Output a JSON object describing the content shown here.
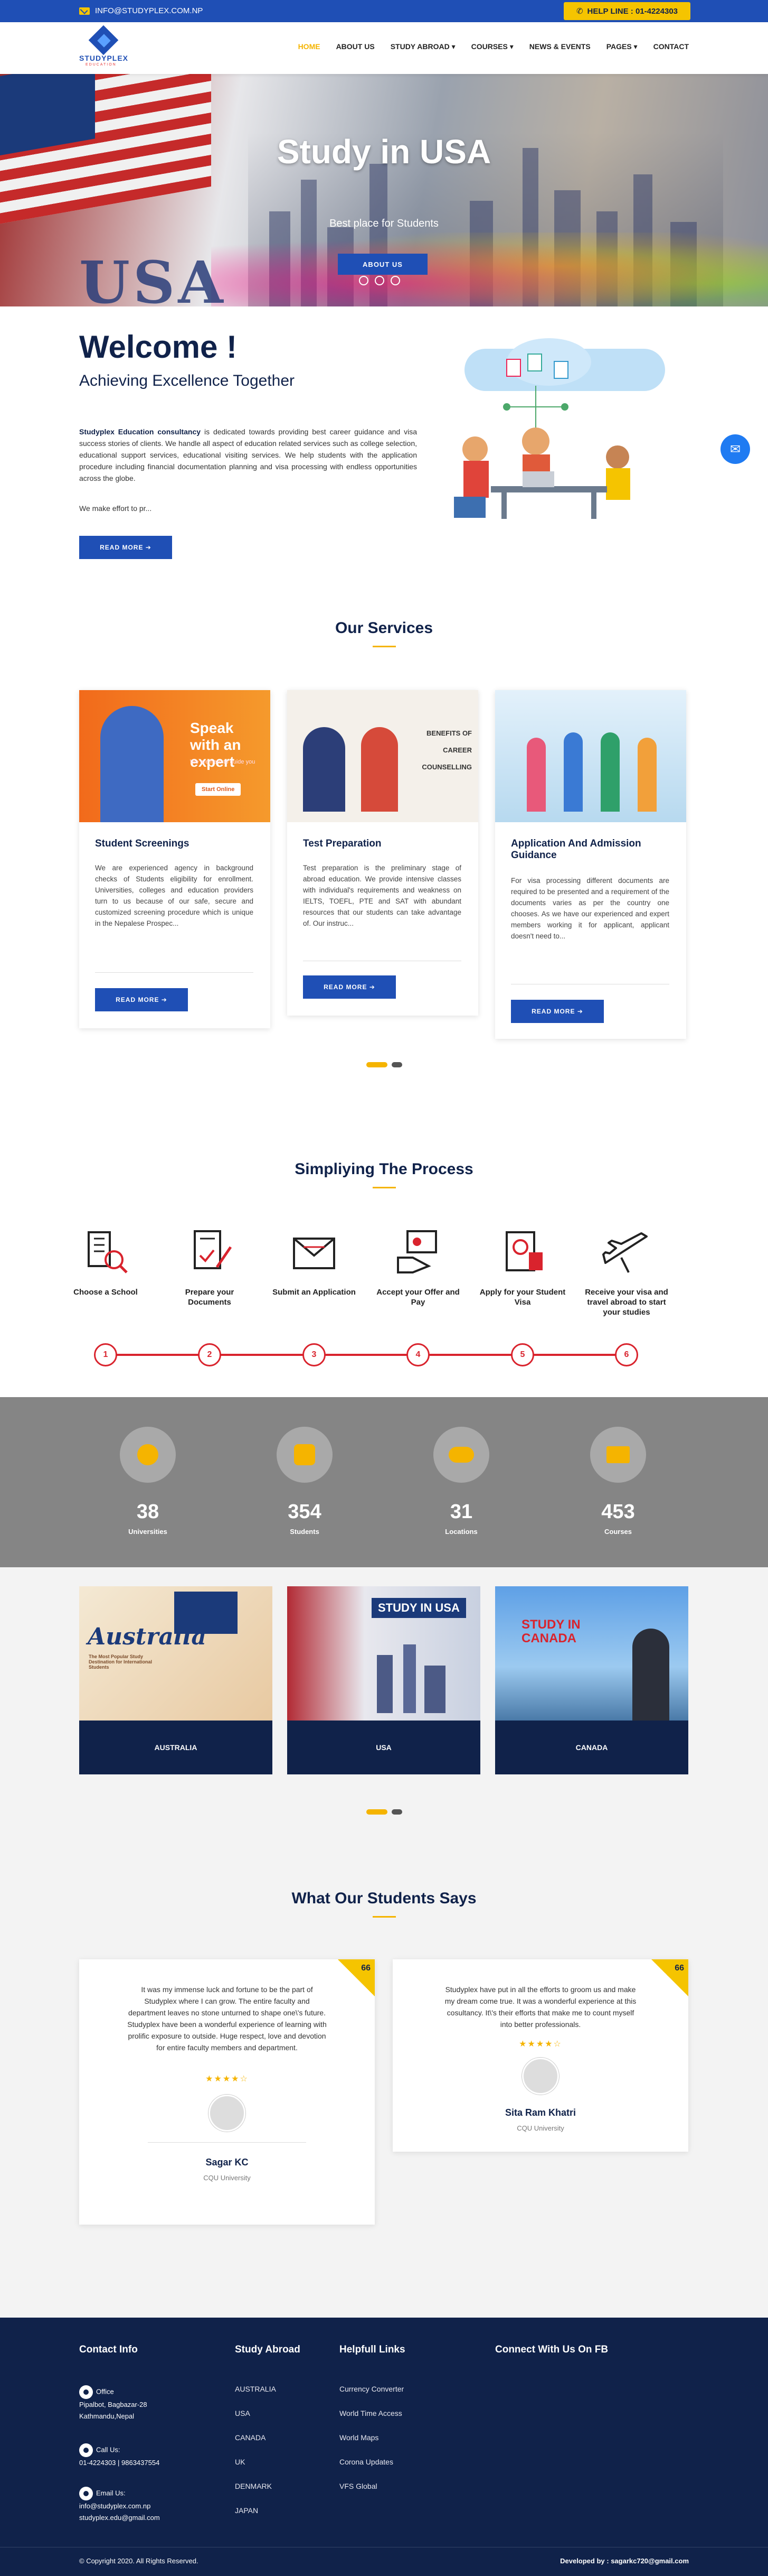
{
  "topbar": {
    "email": "INFO@STUDYPLEX.COM.NP",
    "helpline": "HELP LINE : 01-4224303"
  },
  "brand": {
    "name": "STUDYPLEX",
    "tagline": "EDUCATION"
  },
  "nav": [
    "HOME",
    "ABOUT US",
    "STUDY ABROAD ▾",
    "COURSES ▾",
    "NEWS & EVENTS",
    "PAGES ▾",
    "CONTACT"
  ],
  "hero": {
    "title": "Study in USA",
    "tagline": "Best place for Students",
    "button": "ABOUT US",
    "bg_text": "USA"
  },
  "welcome": {
    "title": "Welcome !",
    "subtitle": "Achieving Excellence Together",
    "brand_bold": "Studyplex Education consultancy",
    "body": " is dedicated towards providing best career guidance and visa success stories of clients.  We handle all aspect of education related services such as college selection, educational support services, educational visiting services.    We  help students with the application procedure including financial documentation planning and visa processing with endless opportunities across the globe.",
    "more": "We make effort to pr...",
    "button": "READ MORE ➔"
  },
  "services": {
    "heading": "Our Services",
    "items": [
      {
        "title": "Student Screenings",
        "img_text": "Speak with an expert",
        "img_sub": "We are here to guide you",
        "img_btn": "Start Online",
        "text": "We are experienced agency in background checks of Students eligibility for enrollment. Universities, colleges and education providers turn to us because of our safe, secure and customized screening procedure which is unique in the Nepalese Prospec...",
        "button": "READ MORE ➔"
      },
      {
        "title": "Test Preparation",
        "img_text": "BENEFITS OF CAREER COUNSELLING",
        "text": "Test preparation is the preliminary stage of abroad education. We provide intensive classes with individual's requirements and weakness on IELTS, TOEFL, PTE and SAT with abundant resources that our students can take advantage of. Our instruc...",
        "button": "READ MORE ➔"
      },
      {
        "title": "Application And Admission Guidance",
        "img_text": "",
        "text": "For visa processing different documents are required to be presented and a requirement of the documents varies as per the country one chooses. As we have our experienced and expert members working it for applicant, applicant doesn't need to...",
        "button": "READ MORE ➔"
      }
    ]
  },
  "process": {
    "heading": "Simpliying The Process",
    "steps": [
      {
        "label": "Choose a School",
        "num": "1",
        "icon": "building-search-icon"
      },
      {
        "label": "Prepare your Documents",
        "num": "2",
        "icon": "document-pen-icon"
      },
      {
        "label": "Submit an Application",
        "num": "3",
        "icon": "envelope-icon"
      },
      {
        "label": "Accept your Offer and Pay",
        "num": "4",
        "icon": "hand-card-icon"
      },
      {
        "label": "Apply for your Student Visa",
        "num": "5",
        "icon": "passport-icon"
      },
      {
        "label": "Receive your visa and travel abroad to start your studies",
        "num": "6",
        "icon": "airplane-icon"
      }
    ]
  },
  "stats": [
    {
      "num": "38",
      "label": "Universities",
      "icon": "badge-icon"
    },
    {
      "num": "354",
      "label": "Students",
      "icon": "user-icon"
    },
    {
      "num": "31",
      "label": "Locations",
      "icon": "group-icon"
    },
    {
      "num": "453",
      "label": "Courses",
      "icon": "book-icon"
    }
  ],
  "destinations": [
    {
      "label": "AUSTRALIA",
      "img_text": "Australia",
      "img_sub": "The Most Popular Study Destination for International Students"
    },
    {
      "label": "USA",
      "img_text": "STUDY IN USA"
    },
    {
      "label": "CANADA",
      "img_text": "STUDY IN CANADA"
    }
  ],
  "testimonials": {
    "heading": "What Our Students Says",
    "items": [
      {
        "text": "It was my immense luck and fortune to be the part of Studyplex where I can grow. The entire faculty and department leaves no stone unturned to shape one\\'s future. Studyplex have been a wonderful experience of learning with prolific exposure to outside. Huge respect, love and devotion for entire faculty members and department.",
        "stars": "★★★★☆",
        "name": "Sagar KC",
        "uni": "CQU University",
        "quote": "66"
      },
      {
        "text": "Studyplex have put in all the efforts to groom us and make my dream come true. It was a wonderful experience at this cosultancy. It\\'s their efforts that make me to count myself into better professionals.",
        "stars": "★★★★☆",
        "name": "Sita Ram Khatri",
        "uni": "CQU University",
        "quote": "66"
      }
    ]
  },
  "footer": {
    "contact": {
      "heading": "Contact Info",
      "office_label": "Office",
      "office": "Pipalbot, Bagbazar-28 Kathmandu,Nepal",
      "call_label": "Call Us:",
      "call": "01-4224303 | 9863437554",
      "email_label": "Email Us:",
      "email1": "info@studyplex.com.np",
      "email2": "studyplex.edu@gmail.com"
    },
    "study": {
      "heading": "Study Abroad",
      "items": [
        "AUSTRALIA",
        "USA",
        "CANADA",
        "UK",
        "DENMARK",
        "JAPAN"
      ]
    },
    "links": {
      "heading": "Helpfull Links",
      "items": [
        "Currency Converter",
        "World Time Access",
        "World Maps",
        "Corona Updates",
        "VFS Global"
      ]
    },
    "fb": {
      "heading": "Connect With Us On FB"
    },
    "copyright": "© Copyright 2020. All Rights Reserved.",
    "developer": "Developed by : sagarkc720@gmail.com"
  },
  "colors": {
    "primary": "#1f4fb5",
    "accent": "#f5b400",
    "navy": "#10224a",
    "process_red": "#d9232d"
  }
}
